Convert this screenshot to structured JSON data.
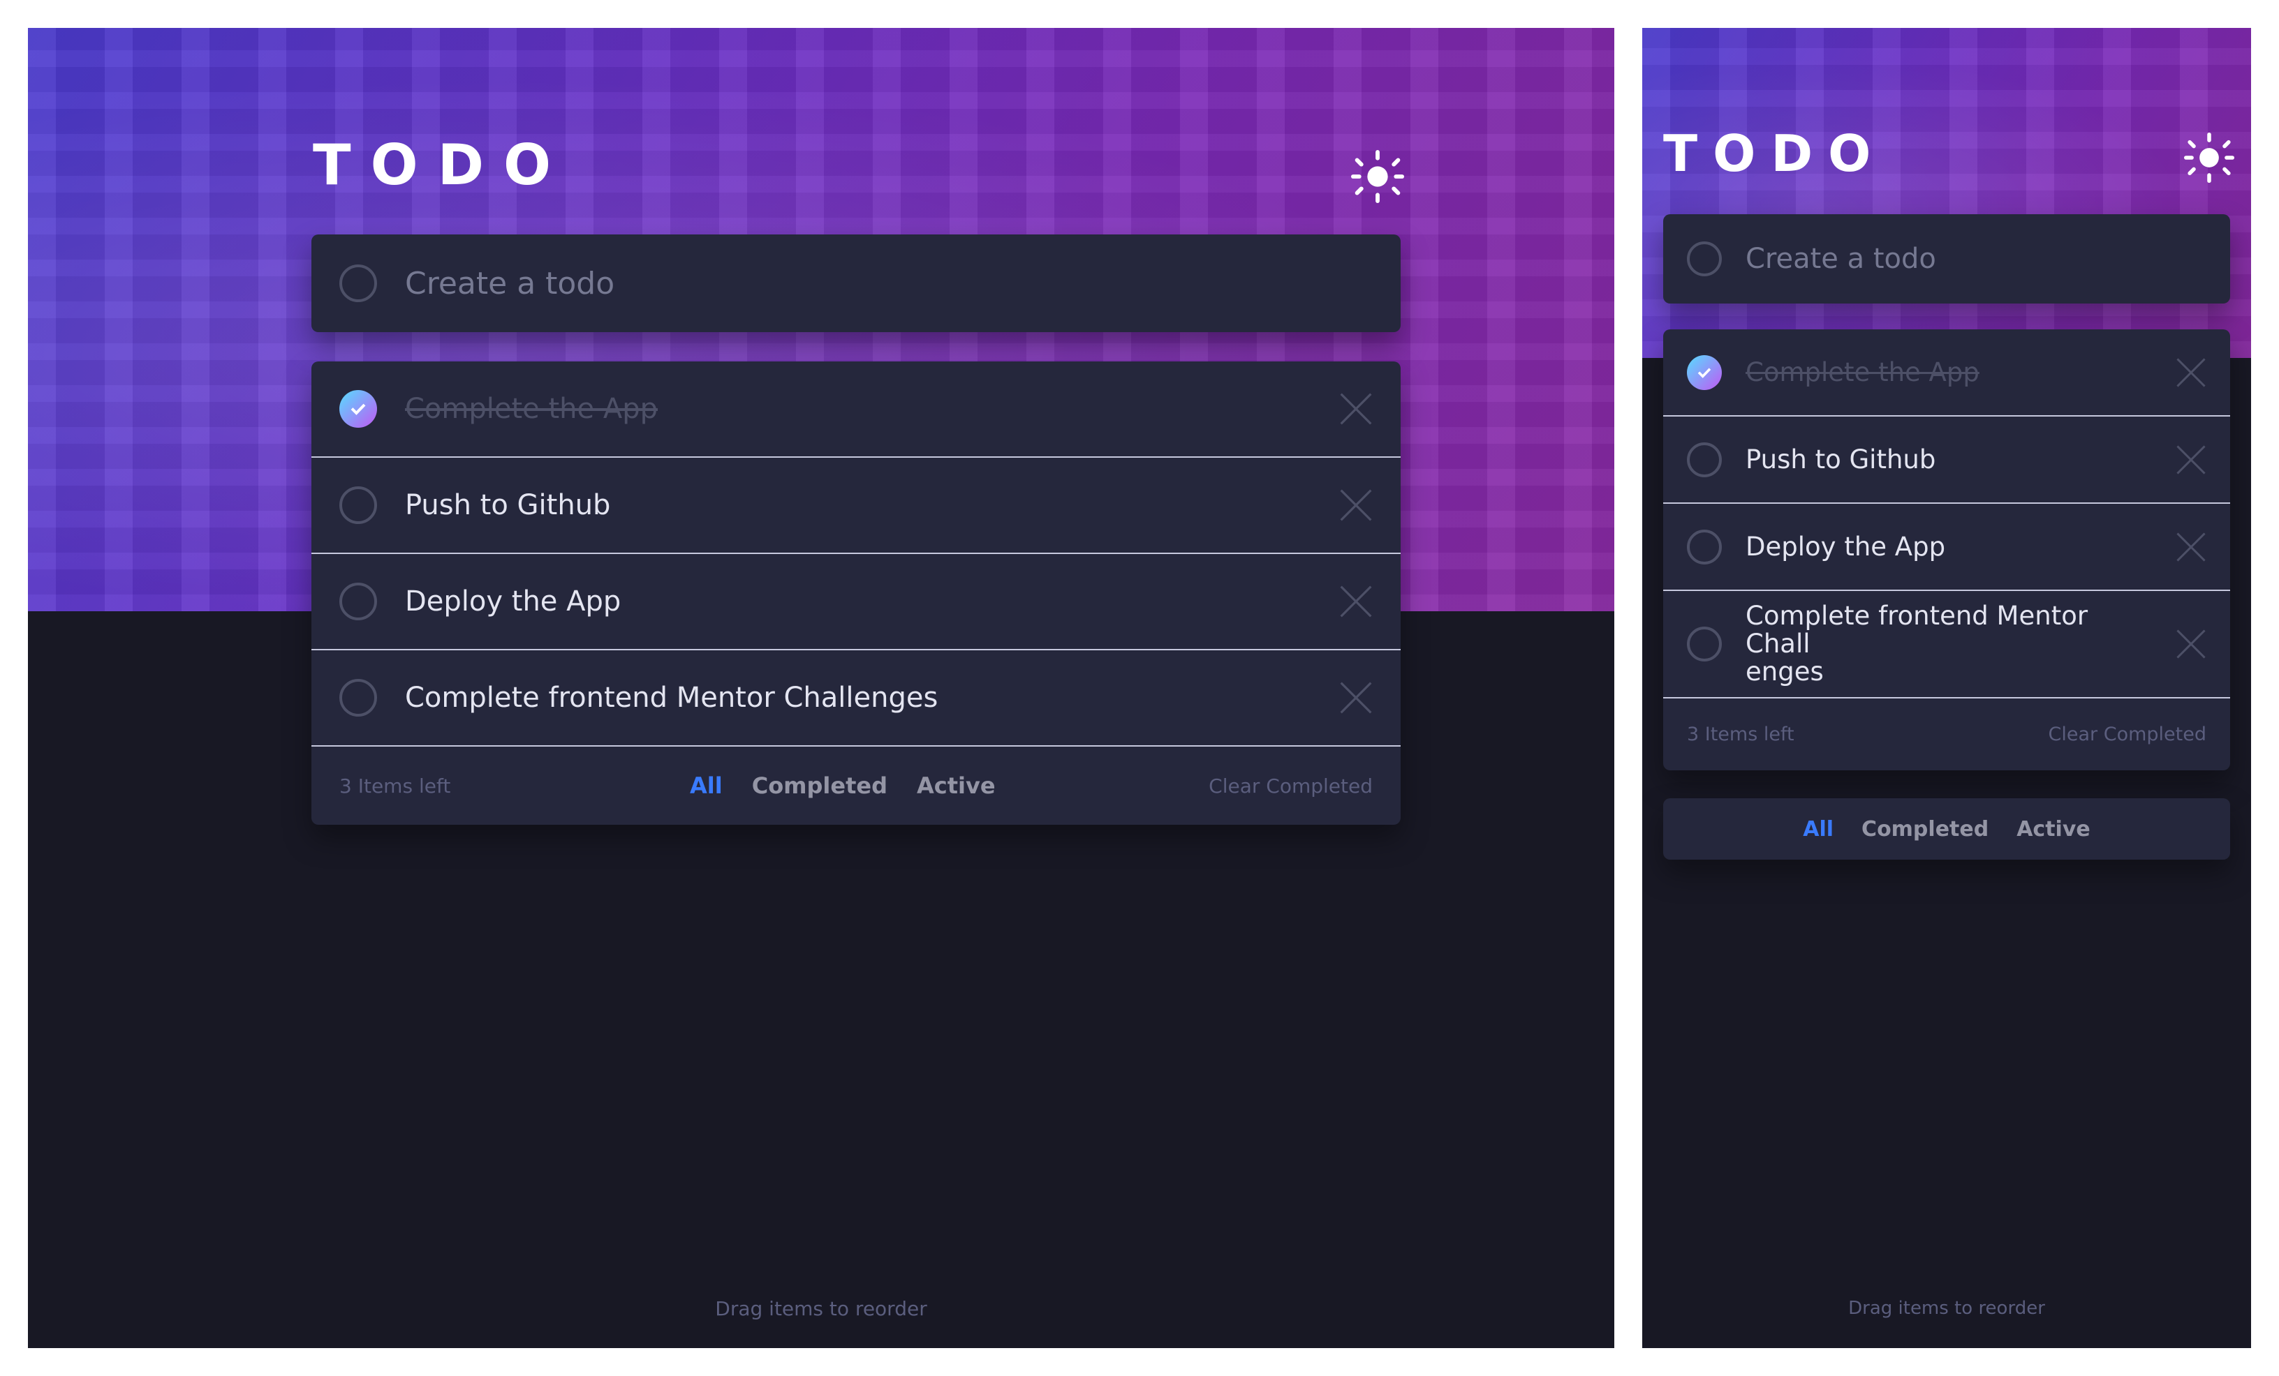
{
  "app": {
    "title": "TODO",
    "theme_toggle_icon": "sun-icon",
    "create_placeholder": "Create a todo",
    "items": [
      {
        "text": "Complete the App",
        "completed": true
      },
      {
        "text": "Push to Github",
        "completed": false
      },
      {
        "text": "Deploy the App",
        "completed": false
      },
      {
        "text": "Complete frontend Mentor Challenges",
        "completed": false
      }
    ],
    "mobile_item_4_lines": [
      "Complete frontend Mentor Chall",
      "enges"
    ],
    "items_left": "3 Items left",
    "filters": [
      "All",
      "Completed",
      "Active"
    ],
    "active_filter": "All",
    "clear_completed": "Clear Completed",
    "drag_hint": "Drag items to reorder",
    "colors": {
      "page_bg": "#181824",
      "card_bg": "#25273c",
      "text": "#e4e5f1",
      "muted": "#5b5e7e",
      "accent": "#3a7bfd",
      "check_gradient_start": "#57ddff",
      "check_gradient_end": "#c058f3"
    }
  }
}
